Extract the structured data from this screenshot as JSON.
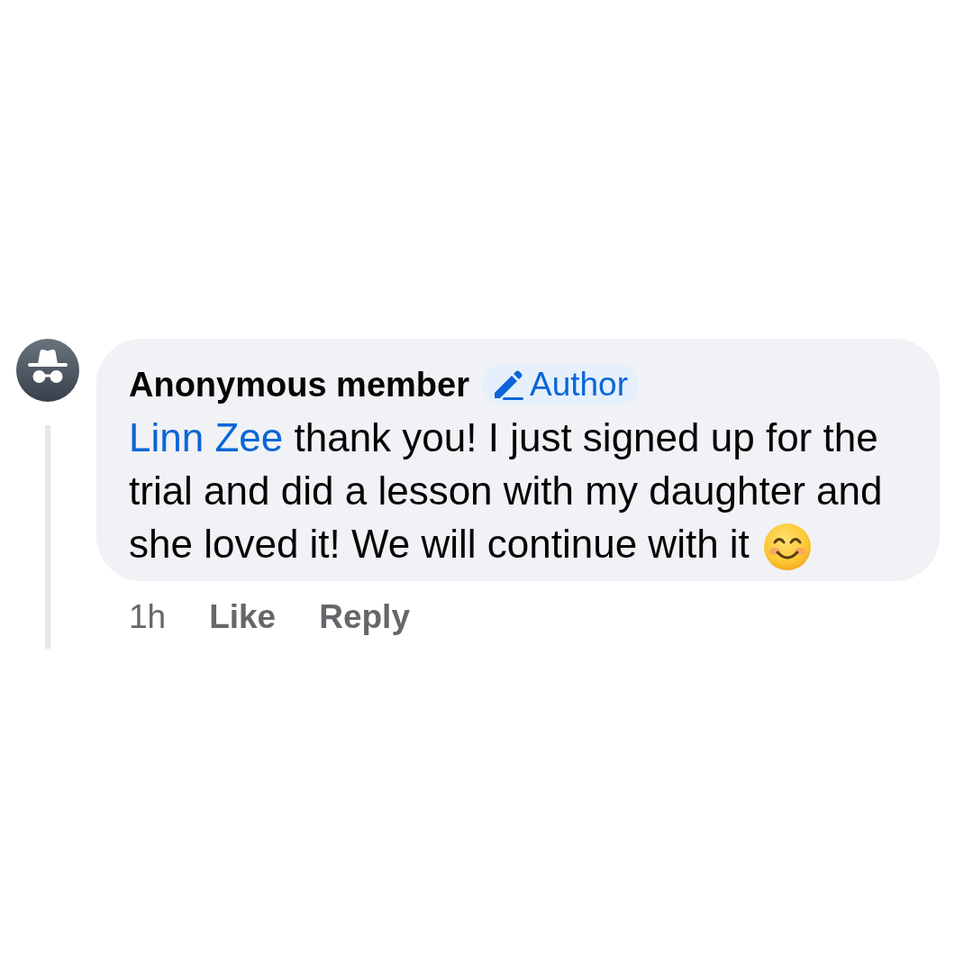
{
  "comment": {
    "author": {
      "name": "Anonymous member",
      "badge": "Author"
    },
    "body": {
      "mention": "Linn Zee",
      "text": "thank you! I just signed up for the trial and did a lesson with my daughter and she loved it! We will continue with it"
    },
    "actions": [
      {
        "kind": "time",
        "label": "1h"
      },
      {
        "kind": "button",
        "label": "Like"
      },
      {
        "kind": "button",
        "label": "Reply"
      }
    ]
  }
}
